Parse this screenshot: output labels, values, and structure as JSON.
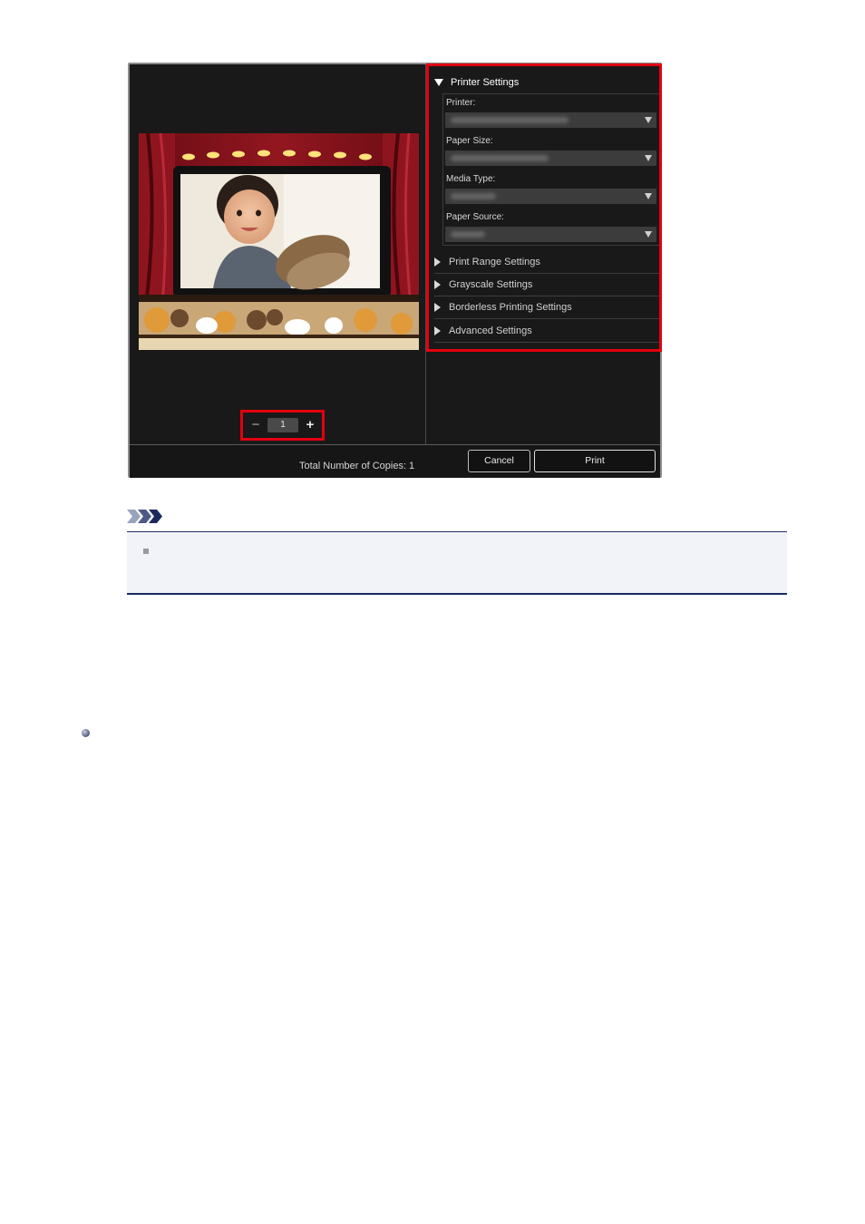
{
  "preview": {
    "copies_value": "1",
    "minus_symbol": "−",
    "plus_symbol": "+"
  },
  "printer_settings": {
    "title": "Printer Settings",
    "fields": [
      {
        "label": "Printer:"
      },
      {
        "label": "Paper Size:"
      },
      {
        "label": "Media Type:"
      },
      {
        "label": "Paper Source:"
      }
    ]
  },
  "sections": [
    {
      "label": "Print Range Settings"
    },
    {
      "label": "Grayscale Settings"
    },
    {
      "label": "Borderless Printing Settings"
    },
    {
      "label": "Advanced Settings"
    }
  ],
  "footer": {
    "total_copies": "Total Number of Copies:  1",
    "cancel_label": "Cancel",
    "print_label": "Print"
  },
  "colors": {
    "highlight": "#e3000f",
    "dialog_bg": "#191919",
    "note_rule": "#1a2a5e"
  },
  "icons": {
    "note": "note-chevrons-icon",
    "expand": "triangle-down-icon",
    "collapsed": "triangle-right-icon",
    "dropdown": "dropdown-arrow-icon"
  }
}
